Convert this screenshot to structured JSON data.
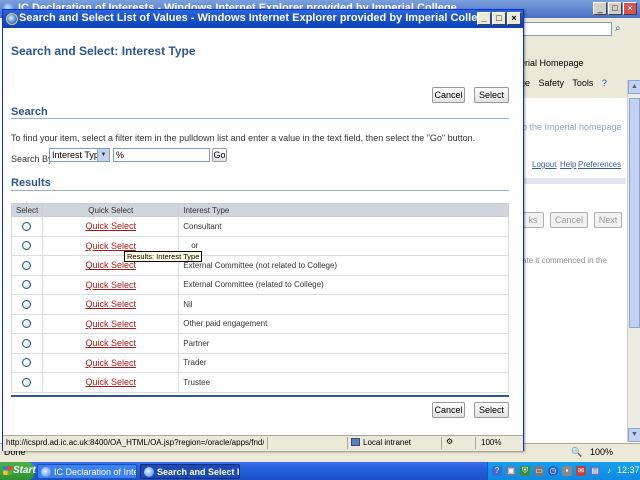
{
  "background_window": {
    "title": "IC Declaration of Interests - Windows Internet Explorer provided by Imperial College",
    "home_tab": "erial Homepage",
    "toolbar": {
      "page": "ge",
      "safety": "Safety",
      "tools": "Tools"
    },
    "link_home": "o the Imperial homepage",
    "header_links": {
      "logout": "Logout",
      "help": "Help",
      "preferences": "Preferences"
    },
    "nav_buttons": {
      "back": "ks",
      "cancel": "Cancel",
      "next": "Next"
    },
    "commenced_text": "ate it commenced in the",
    "status_done": "Done",
    "zoom": "100%"
  },
  "popup": {
    "title": "Search and Select List of Values - Windows Internet Explorer provided by Imperial College",
    "page_title": "Search and Select: Interest Type",
    "buttons": {
      "cancel": "Cancel",
      "select": "Select"
    },
    "search": {
      "heading": "Search",
      "instructions": "To find your item, select a filter item in the pulldown list and enter a value in the text field, then select the \"Go\" button.",
      "search_by_label": "Search By",
      "filter_value": "Interest Type",
      "text_value": "%",
      "go_label": "Go"
    },
    "results": {
      "heading": "Results",
      "columns": [
        "Select",
        "Quick Select",
        "Interest Type"
      ],
      "quick_select_label": "Quick Select",
      "rows": [
        {
          "interest_type": "Consultant"
        },
        {
          "interest_type": "or"
        },
        {
          "interest_type": "External Committee (not related to College)"
        },
        {
          "interest_type": "External Committee (related to College)"
        },
        {
          "interest_type": "Nil"
        },
        {
          "interest_type": "Other paid engagement"
        },
        {
          "interest_type": "Partner"
        },
        {
          "interest_type": "Trader"
        },
        {
          "interest_type": "Trustee"
        }
      ],
      "tooltip": "Results: Interest Type"
    },
    "status": {
      "url": "http://icsprd.ad.ic.ac.uk:8400/OA_HTML/OA.jsp?region=/oracle/apps/fnd/framew",
      "zone": "Local intranet",
      "zoom": "100%"
    }
  },
  "taskbar": {
    "start": "Start",
    "tasks": [
      "IC Declaration of Interes...",
      "Search and Select Lis..."
    ],
    "clock": "12:37"
  },
  "colors": {
    "heading": "#2a5591",
    "link": "#b01717",
    "titlebar": "#0a3fb8"
  }
}
